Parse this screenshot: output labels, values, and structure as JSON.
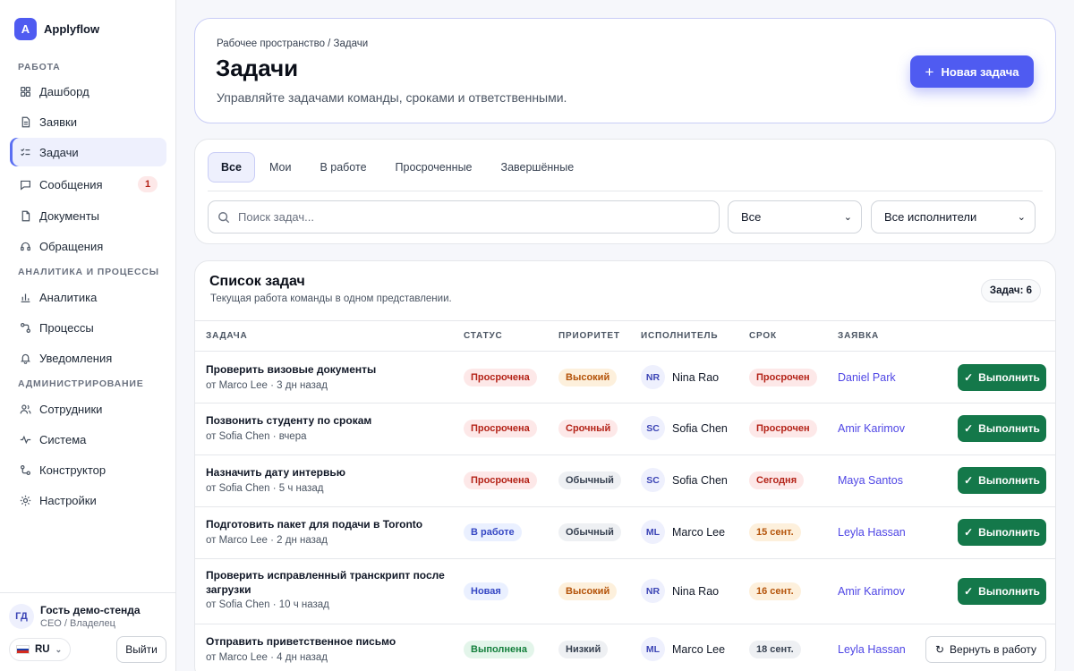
{
  "app": {
    "logo_letter": "A",
    "name": "Applyflow"
  },
  "sidebar": {
    "sections": [
      {
        "title": "Работа"
      },
      {
        "title": "Аналитика и процессы"
      },
      {
        "title": "Администрирование"
      }
    ],
    "items": [
      {
        "label": "Дашборд",
        "icon": "dashboard-icon"
      },
      {
        "label": "Заявки",
        "icon": "applications-icon"
      },
      {
        "label": "Задачи",
        "icon": "tasks-icon",
        "active": true
      },
      {
        "label": "Сообщения",
        "icon": "messages-icon",
        "badge": "1"
      },
      {
        "label": "Документы",
        "icon": "documents-icon"
      },
      {
        "label": "Обращения",
        "icon": "support-icon"
      },
      {
        "label": "Аналитика",
        "icon": "analytics-icon"
      },
      {
        "label": "Процессы",
        "icon": "processes-icon"
      },
      {
        "label": "Уведомления",
        "icon": "bell-icon"
      },
      {
        "label": "Сотрудники",
        "icon": "users-icon"
      },
      {
        "label": "Система",
        "icon": "activity-icon"
      },
      {
        "label": "Конструктор",
        "icon": "builder-icon"
      },
      {
        "label": "Настройки",
        "icon": "settings-icon"
      }
    ],
    "user": {
      "initials": "ГД",
      "name": "Гость демо-стенда",
      "role": "CEO / Владелец"
    },
    "language": "RU",
    "logout_label": "Выйти"
  },
  "header": {
    "breadcrumb": "Рабочее пространство / Задачи",
    "title": "Задачи",
    "subtitle": "Управляйте задачами команды, сроками и ответственными.",
    "new_task_label": "Новая задача"
  },
  "filters": {
    "tabs": [
      {
        "label": "Все",
        "active": true
      },
      {
        "label": "Мои"
      },
      {
        "label": "В работе"
      },
      {
        "label": "Просроченные"
      },
      {
        "label": "Завершённые"
      }
    ],
    "search_placeholder": "Поиск задач...",
    "status_select": "Все",
    "assignee_select": "Все исполнители"
  },
  "task_list": {
    "title": "Список задач",
    "subtitle": "Текущая работа команды в одном представлении.",
    "count_label": "Задач: 6",
    "columns": [
      "Задача",
      "Статус",
      "Приоритет",
      "Исполнитель",
      "Срок",
      "Заявка"
    ],
    "rows": [
      {
        "title": "Проверить визовые документы",
        "meta": "от Marco Lee · 3 дн назад",
        "status": "Просрочена",
        "status_color": "red",
        "priority": "Высокий",
        "priority_color": "orange",
        "assignee_initials": "NR",
        "assignee": "Nina Rao",
        "due": "Просрочен",
        "due_color": "red",
        "request": "Daniel Park",
        "action": "Выполнить"
      },
      {
        "title": "Позвонить студенту по срокам",
        "meta": "от Sofia Chen · вчера",
        "status": "Просрочена",
        "status_color": "red",
        "priority": "Срочный",
        "priority_color": "red",
        "assignee_initials": "SC",
        "assignee": "Sofia Chen",
        "due": "Просрочен",
        "due_color": "red",
        "request": "Amir Karimov",
        "action": "Выполнить"
      },
      {
        "title": "Назначить дату интервью",
        "meta": "от Sofia Chen · 5 ч назад",
        "status": "Просрочена",
        "status_color": "red",
        "priority": "Обычный",
        "priority_color": "gray",
        "assignee_initials": "SC",
        "assignee": "Sofia Chen",
        "due": "Сегодня",
        "due_color": "red",
        "request": "Maya Santos",
        "action": "Выполнить"
      },
      {
        "title": "Подготовить пакет для подачи в Toronto",
        "meta": "от Marco Lee · 2 дн назад",
        "status": "В работе",
        "status_color": "blue",
        "priority": "Обычный",
        "priority_color": "gray",
        "assignee_initials": "ML",
        "assignee": "Marco Lee",
        "due": "15 сент.",
        "due_color": "orange",
        "request": "Leyla Hassan",
        "action": "Выполнить"
      },
      {
        "title": "Проверить исправленный транскрипт после загрузки",
        "meta": "от Sofia Chen · 10 ч назад",
        "status": "Новая",
        "status_color": "blue",
        "priority": "Высокий",
        "priority_color": "orange",
        "assignee_initials": "NR",
        "assignee": "Nina Rao",
        "due": "16 сент.",
        "due_color": "orange",
        "request": "Amir Karimov",
        "action": "Выполнить"
      },
      {
        "title": "Отправить приветственное письмо",
        "meta": "от Marco Lee · 4 дн назад",
        "status": "Выполнена",
        "status_color": "green",
        "priority": "Низкий",
        "priority_color": "gray",
        "assignee_initials": "ML",
        "assignee": "Marco Lee",
        "due": "18 сент.",
        "due_color": "gray",
        "request": "Leyla Hassan",
        "action": "Вернуть в работу"
      }
    ]
  },
  "colors": {
    "accent": "#4f5bf1",
    "success_button": "#14784a",
    "link": "#4f46e5"
  }
}
